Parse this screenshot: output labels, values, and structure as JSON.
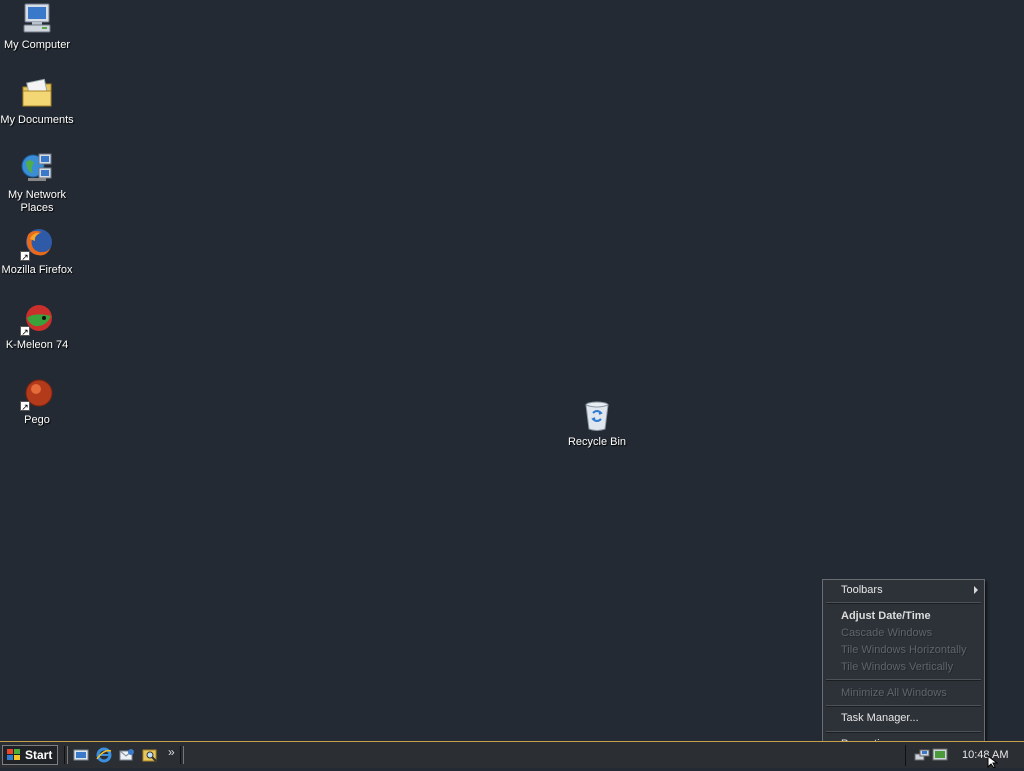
{
  "desktop": {
    "icons": [
      {
        "label": "My Computer",
        "icon": "computer-icon"
      },
      {
        "label": "My Documents",
        "icon": "folder-icon"
      },
      {
        "label": "My Network Places",
        "icon": "network-icon"
      },
      {
        "label": "Mozilla Firefox",
        "icon": "firefox-icon"
      },
      {
        "label": "K-Meleon 74",
        "icon": "kmeleon-icon"
      },
      {
        "label": "Pego",
        "icon": "pego-icon"
      },
      {
        "label": "Recycle Bin",
        "icon": "recycle-bin-icon"
      }
    ]
  },
  "taskbar": {
    "start_label": "Start",
    "quick_launch": [
      "show-desktop-icon",
      "internet-explorer-icon",
      "outlook-express-icon",
      "search-icon"
    ],
    "more": "»",
    "tray_icons": [
      "network-tray-icon",
      "display-tray-icon"
    ],
    "clock": "10:48 AM"
  },
  "context_menu": {
    "items": [
      {
        "label": "Toolbars"
      },
      {
        "label": "Adjust Date/Time"
      },
      {
        "label": "Cascade Windows"
      },
      {
        "label": "Tile Windows Horizontally"
      },
      {
        "label": "Tile Windows Vertically"
      },
      {
        "label": "Minimize All Windows"
      },
      {
        "label": "Task Manager..."
      },
      {
        "label": "Properties"
      }
    ]
  },
  "colors": {
    "desktop": "#232a33",
    "menu_bg": "#2d3238",
    "disabled_text": "#5e646b",
    "taskbar_accent": "#c7a04e"
  }
}
